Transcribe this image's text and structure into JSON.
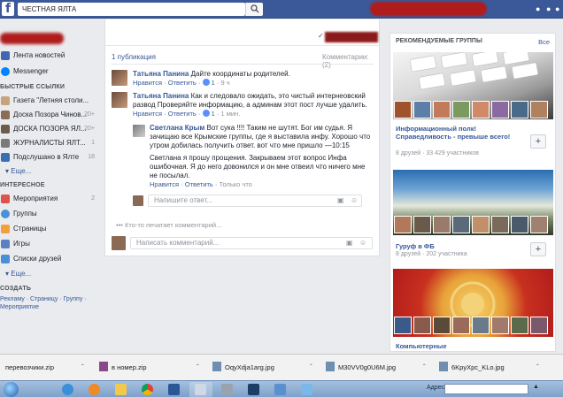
{
  "topbar": {
    "search_value": "ЧЕСТНАЯ ЯЛТА"
  },
  "sidebar": {
    "items_top": [
      {
        "label": "Лента новостей",
        "icon": "news-feed-icon",
        "color": "#4267b2"
      },
      {
        "label": "Messenger",
        "icon": "messenger-icon",
        "color": "#0084ff"
      }
    ],
    "quick_links_head": "БЫСТРЫЕ ССЫЛКИ",
    "quick_links": [
      {
        "label": "Газета \"Летняя столи...",
        "count": "",
        "color": "#c8a27a"
      },
      {
        "label": "Доска Позора Чинов...",
        "count": "20+",
        "color": "#8a6d55"
      },
      {
        "label": "ДОСКА ПОЗОРА ЯЛ...",
        "count": "20+",
        "color": "#6d5b4b"
      },
      {
        "label": "ЖУРНАЛИСТЫ ЯЛТ...",
        "count": "1",
        "color": "#7a7a7a"
      },
      {
        "label": "Подслушано в Ялте",
        "count": "18",
        "color": "#3b6fb5"
      }
    ],
    "more_1": "Еще...",
    "interests_head": "ИНТЕРЕСНОЕ",
    "interests": [
      {
        "label": "Мероприятия",
        "count": "2",
        "icon": "calendar-icon",
        "color": "#e0524c"
      },
      {
        "label": "Группы",
        "count": "",
        "icon": "groups-icon",
        "color": "#4a90d9"
      },
      {
        "label": "Страницы",
        "count": "",
        "icon": "pages-icon",
        "color": "#f2a13a"
      },
      {
        "label": "Игры",
        "count": "",
        "icon": "games-icon",
        "color": "#5b7fc3"
      },
      {
        "label": "Списки друзей",
        "count": "",
        "icon": "friends-list-icon",
        "color": "#4a90d9"
      }
    ],
    "more_2": "Еще...",
    "create_head": "СОЗДАТЬ",
    "create_links": "Рекламу · Страницу · Группу · Мероприятие"
  },
  "center": {
    "pub_count": "1 публикация",
    "comments_label": "Комментарии: (2)",
    "comments": [
      {
        "author": "Татьяна Панина",
        "text": "Дайте координаты родителей.",
        "like": "Нравится",
        "reply": "Ответить",
        "likes": "1",
        "time": "9 ч"
      },
      {
        "author": "Татьяна Панина",
        "text": "Как и следовало ожидать, это чистый интернеовский развод Проверяйте информацию, а админам этот пост лучше удалить.",
        "like": "Нравится",
        "reply": "Ответить",
        "likes": "1",
        "time": "1 мин."
      }
    ],
    "reply": {
      "author": "Светлана Крым",
      "text": "Вот сука !!!! Таким не шутят. Бог им судья. Я зачищаю все Крымские группы, где я выставила инфу. Хорошо что утром добилась получить ответ. вот что мне пришло —10:15",
      "text2": "Светлана я прошу прощения. Закрываем этот вопрос Инфа ошибочная. Я до него довонился и он мне отвеил что ничего мне не посылал.",
      "like": "Нравится",
      "reply": "Ответить",
      "time": "Только что"
    },
    "reply_placeholder": "Напишите ответ...",
    "typing": "Кто-то печатает комментарий...",
    "comment_placeholder": "Написать комментарий..."
  },
  "right": {
    "head": "РЕКОМЕНДУЕМЫЕ ГРУППЫ",
    "all": "Все",
    "groups": [
      {
        "title": "Информационный полк! Справедливость - превыше всего!",
        "sub": "8 друзей · 33 429 участников"
      },
      {
        "title": "Гуруф в ФБ",
        "sub": "8 друзей · 202 участника"
      },
      {
        "title": "Компьютерные",
        "sub": ""
      }
    ]
  },
  "downloads": [
    {
      "name": "перевозчики.zip",
      "color": "#d7c8a0"
    },
    {
      "name": "в номер.zip",
      "color": "#8a4a8a"
    },
    {
      "name": "OqyXdja1arg.jpg",
      "color": "#6f8fb0"
    },
    {
      "name": "M30VV0g0U6M.jpg",
      "color": "#6f8fb0"
    },
    {
      "name": "6KpyXpc_KLo.jpg",
      "color": "#6f8fb0"
    }
  ],
  "taskbar": {
    "address_label": "Адрес"
  }
}
